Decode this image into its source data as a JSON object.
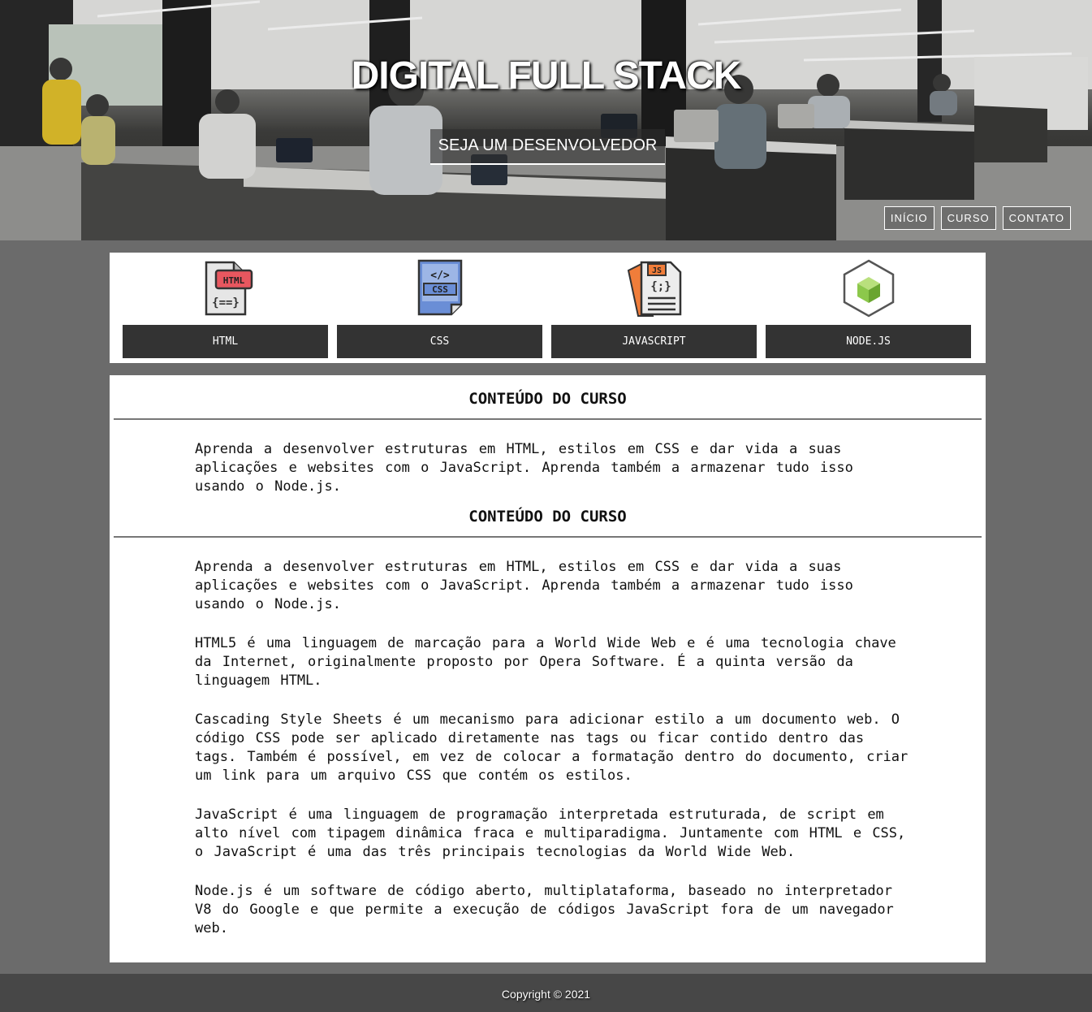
{
  "hero": {
    "title": "DIGITAL FULL STACK",
    "cta_label": "SEJA UM DESENVOLVEDOR"
  },
  "nav": {
    "items": [
      {
        "label": "INÍCIO"
      },
      {
        "label": "CURSO"
      },
      {
        "label": "CONTATO"
      }
    ]
  },
  "tech": {
    "items": [
      {
        "label": "HTML",
        "icon": "html-file-icon"
      },
      {
        "label": "CSS",
        "icon": "css-file-icon"
      },
      {
        "label": "JAVASCRIPT",
        "icon": "javascript-file-icon"
      },
      {
        "label": "NODE.JS",
        "icon": "nodejs-cube-icon"
      }
    ]
  },
  "content": {
    "sections": [
      {
        "title": "CONTEÚDO DO CURSO",
        "paragraphs": [
          "Aprenda a desenvolver estruturas em HTML, estilos em CSS e dar vida a suas aplicações e websites com o JavaScript. Aprenda também a armazenar tudo isso usando o Node.js."
        ]
      },
      {
        "title": "CONTEÚDO DO CURSO",
        "paragraphs": [
          "Aprenda a desenvolver estruturas em HTML, estilos em CSS e dar vida a suas aplicações e websites com o JavaScript. Aprenda também a armazenar tudo isso usando o Node.js.",
          "HTML5 é uma linguagem de marcação para a World Wide Web e é uma tecnologia chave da Internet, originalmente proposto por Opera Software. É a quinta versão da linguagem HTML.",
          "Cascading Style Sheets é um mecanismo para adicionar estilo a um documento web. O código CSS pode ser aplicado diretamente nas tags ou ficar contido dentro das tags. Também é possível, em vez de colocar a formatação dentro do documento, criar um link para um arquivo CSS que contém os estilos.",
          "JavaScript é uma linguagem de programação interpretada estruturada, de script em alto nível com tipagem dinâmica fraca e multiparadigma. Juntamente com HTML e CSS, o JavaScript é uma das três principais tecnologias da World Wide Web.",
          "Node.js é um software de código aberto, multiplataforma, baseado no interpretador V8 do Google e que permite a execução de códigos JavaScript fora de um navegador web."
        ]
      }
    ]
  },
  "footer": {
    "copyright": "Copyright © 2021"
  },
  "colors": {
    "page_bg": "#6b6b6b",
    "button_bg": "#333333",
    "footer_bg": "#474747",
    "html_red": "#e8575f",
    "css_blue": "#6a8ed6",
    "js_orange": "#f07d3a",
    "node_green": "#8cc84b"
  }
}
